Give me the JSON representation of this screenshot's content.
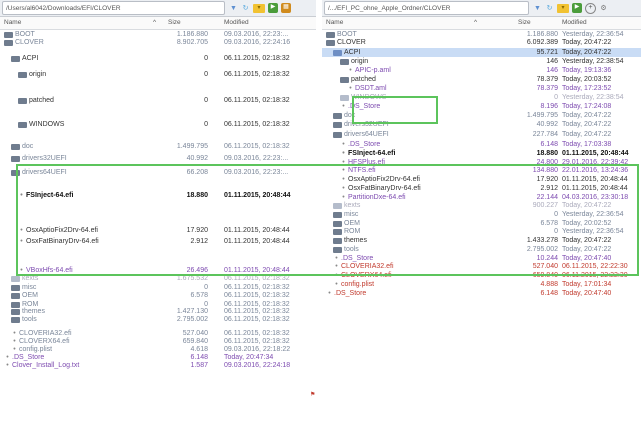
{
  "left": {
    "path": "/Users/al6042/Downloads/EFI/CLOVER",
    "columns": {
      "name": "Name",
      "size": "Size",
      "modified": "Modified"
    },
    "rows": [
      {
        "name": "BOOT",
        "size": "1.186.880",
        "modified": "09.03.2016, 22:23:...",
        "type": "folder",
        "indent": 0,
        "style": "muted"
      },
      {
        "name": "CLOVER",
        "size": "8.902.705",
        "modified": "09.03.2016, 22:24:16",
        "type": "folder",
        "indent": 0,
        "style": "muted"
      },
      {
        "name": "ACPI",
        "size": "0",
        "modified": "06.11.2015, 02:18:32",
        "type": "folder",
        "indent": 1,
        "style": "normal"
      },
      {
        "name": "origin",
        "size": "0",
        "modified": "06.11.2015, 02:18:32",
        "type": "folder",
        "indent": 2,
        "style": "normal"
      },
      {
        "name": "patched",
        "size": "0",
        "modified": "06.11.2015, 02:18:32",
        "type": "folder",
        "indent": 2,
        "style": "normal"
      },
      {
        "name": "WINDOWS",
        "size": "0",
        "modified": "06.11.2015, 02:18:32",
        "type": "folder",
        "indent": 2,
        "style": "normal"
      },
      {
        "name": "doc",
        "size": "1.499.795",
        "modified": "06.11.2015, 02:18:32",
        "type": "folder",
        "indent": 1,
        "style": "muted"
      },
      {
        "name": "drivers32UEFI",
        "size": "40.992",
        "modified": "09.03.2016, 22:23:...",
        "type": "folder",
        "indent": 1,
        "style": "muted"
      },
      {
        "name": "drivers64UEFI",
        "size": "66.208",
        "modified": "09.03.2016, 22:23:...",
        "type": "folder",
        "indent": 1,
        "style": "muted"
      },
      {
        "name": "FSInject-64.efi",
        "size": "18.880",
        "modified": "01.11.2015, 20:48:44",
        "type": "file",
        "indent": 2,
        "style": "strong"
      },
      {
        "name": "OsxAptioFix2Drv-64.efi",
        "size": "17.920",
        "modified": "01.11.2015, 20:48:44",
        "type": "file",
        "indent": 2,
        "style": "normal"
      },
      {
        "name": "OsxFatBinaryDrv-64.efi",
        "size": "2.912",
        "modified": "01.11.2015, 20:48:44",
        "type": "file",
        "indent": 2,
        "style": "normal"
      },
      {
        "name": "VBoxHfs-64.efi",
        "size": "26.496",
        "modified": "01.11.2015, 20:48:44",
        "type": "file",
        "indent": 2,
        "style": "purple"
      },
      {
        "name": "kexts",
        "size": "1.675.532",
        "modified": "06.11.2015, 02:18:32",
        "type": "folder",
        "indent": 1,
        "style": "dim"
      },
      {
        "name": "misc",
        "size": "0",
        "modified": "06.11.2015, 02:18:32",
        "type": "folder",
        "indent": 1,
        "style": "muted"
      },
      {
        "name": "OEM",
        "size": "6.578",
        "modified": "06.11.2015, 02:18:32",
        "type": "folder",
        "indent": 1,
        "style": "muted"
      },
      {
        "name": "ROM",
        "size": "0",
        "modified": "06.11.2015, 02:18:32",
        "type": "folder",
        "indent": 1,
        "style": "muted"
      },
      {
        "name": "themes",
        "size": "1.427.130",
        "modified": "06.11.2015, 02:18:32",
        "type": "folder",
        "indent": 1,
        "style": "muted"
      },
      {
        "name": "tools",
        "size": "2.795.002",
        "modified": "06.11.2015, 02:18:32",
        "type": "folder",
        "indent": 1,
        "style": "muted"
      },
      {
        "name": "CLOVERIA32.efi",
        "size": "527.040",
        "modified": "06.11.2015, 02:18:32",
        "type": "file",
        "indent": 1,
        "style": "muted"
      },
      {
        "name": "CLOVERX64.efi",
        "size": "659.840",
        "modified": "06.11.2015, 02:18:32",
        "type": "file",
        "indent": 1,
        "style": "muted"
      },
      {
        "name": "config.plist",
        "size": "4.618",
        "modified": "09.03.2016, 22:18:22",
        "type": "file",
        "indent": 1,
        "style": "muted"
      },
      {
        "name": ".DS_Store",
        "size": "6.148",
        "modified": "Today, 20:47:34",
        "type": "file",
        "indent": 0,
        "style": "purple"
      },
      {
        "name": "Clover_Install_Log.txt",
        "size": "1.587",
        "modified": "09.03.2016, 22:24:18",
        "type": "file",
        "indent": 0,
        "style": "purple"
      }
    ]
  },
  "right": {
    "path": "/.../EFI_PC_ohne_Apple_Ordner/CLOVER",
    "columns": {
      "name": "Name",
      "size": "Size",
      "modified": "Modified"
    },
    "rows": [
      {
        "name": "BOOT",
        "size": "1.186.880",
        "modified": "Yesterday, 22:36:54",
        "type": "folder",
        "indent": 0,
        "style": "muted"
      },
      {
        "name": "CLOVER",
        "size": "6.092.389",
        "modified": "Today, 20:47:22",
        "type": "folder",
        "indent": 0,
        "style": "normal"
      },
      {
        "name": "ACPI",
        "size": "95.721",
        "modified": "Today, 20:47:22",
        "type": "folder",
        "indent": 1,
        "style": "sel"
      },
      {
        "name": "origin",
        "size": "146",
        "modified": "Yesterday, 22:38:54",
        "type": "folder",
        "indent": 2,
        "style": "normal"
      },
      {
        "name": "APIC-p.aml",
        "size": "146",
        "modified": "Today, 19:13:36",
        "type": "file",
        "indent": 3,
        "style": "purple"
      },
      {
        "name": "patched",
        "size": "78.379",
        "modified": "Today, 20:03:52",
        "type": "folder",
        "indent": 2,
        "style": "normal"
      },
      {
        "name": "DSDT.aml",
        "size": "78.379",
        "modified": "Today, 17:23:52",
        "type": "file",
        "indent": 3,
        "style": "purple"
      },
      {
        "name": "WINDOWS",
        "size": "0",
        "modified": "Yesterday, 22:38:54",
        "type": "folder",
        "indent": 2,
        "style": "dim"
      },
      {
        "name": ".DS_Store",
        "size": "8.196",
        "modified": "Today, 17:24:08",
        "type": "file",
        "indent": 2,
        "style": "purple"
      },
      {
        "name": "doc",
        "size": "1.499.795",
        "modified": "Today, 20:47:22",
        "type": "folder",
        "indent": 1,
        "style": "muted"
      },
      {
        "name": "drivers32UEFI",
        "size": "40.992",
        "modified": "Today, 20:47:22",
        "type": "folder",
        "indent": 1,
        "style": "muted"
      },
      {
        "name": "drivers64UEFI",
        "size": "227.784",
        "modified": "Today, 20:47:22",
        "type": "folder",
        "indent": 1,
        "style": "muted"
      },
      {
        "name": ".DS_Store",
        "size": "6.148",
        "modified": "Today, 17:03:38",
        "type": "file",
        "indent": 2,
        "style": "purple"
      },
      {
        "name": "FSInject-64.efi",
        "size": "18.880",
        "modified": "01.11.2015, 20:48:44",
        "type": "file",
        "indent": 2,
        "style": "strong"
      },
      {
        "name": "HFSPlus.efi",
        "size": "24.800",
        "modified": "29.01.2016, 22:39:42",
        "type": "file",
        "indent": 2,
        "style": "purple"
      },
      {
        "name": "NTFS.efi",
        "size": "134.880",
        "modified": "22.01.2016, 13:24:36",
        "type": "file",
        "indent": 2,
        "style": "purple"
      },
      {
        "name": "OsxAptioFix2Drv-64.efi",
        "size": "17.920",
        "modified": "01.11.2015, 20:48:44",
        "type": "file",
        "indent": 2,
        "style": "normal"
      },
      {
        "name": "OsxFatBinaryDrv-64.efi",
        "size": "2.912",
        "modified": "01.11.2015, 20:48:44",
        "type": "file",
        "indent": 2,
        "style": "normal"
      },
      {
        "name": "PartitionDxe-64.efi",
        "size": "22.144",
        "modified": "04.03.2016, 23:30:18",
        "type": "file",
        "indent": 2,
        "style": "purple"
      },
      {
        "name": "kexts",
        "size": "900.227",
        "modified": "Today, 20:47:22",
        "type": "folder",
        "indent": 1,
        "style": "dim"
      },
      {
        "name": "misc",
        "size": "0",
        "modified": "Yesterday, 22:36:54",
        "type": "folder",
        "indent": 1,
        "style": "muted"
      },
      {
        "name": "OEM",
        "size": "6.578",
        "modified": "Today, 20:02:52",
        "type": "folder",
        "indent": 1,
        "style": "muted"
      },
      {
        "name": "ROM",
        "size": "0",
        "modified": "Yesterday, 22:36:54",
        "type": "folder",
        "indent": 1,
        "style": "muted"
      },
      {
        "name": "themes",
        "size": "1.433.278",
        "modified": "Today, 20:47:22",
        "type": "folder",
        "indent": 1,
        "style": "normal"
      },
      {
        "name": "tools",
        "size": "2.795.002",
        "modified": "Today, 20:47:22",
        "type": "folder",
        "indent": 1,
        "style": "muted"
      },
      {
        "name": ".DS_Store",
        "size": "10.244",
        "modified": "Today, 20:47:40",
        "type": "file",
        "indent": 1,
        "style": "purple"
      },
      {
        "name": "CLOVERIA32.efi",
        "size": "527.040",
        "modified": "06.11.2015, 22:22:30",
        "type": "file",
        "indent": 1,
        "style": "red"
      },
      {
        "name": "CLOVERX64.efi",
        "size": "659.840",
        "modified": "06.11.2015, 22:22:30",
        "type": "file",
        "indent": 1,
        "style": "red"
      },
      {
        "name": "config.plist",
        "size": "4.888",
        "modified": "Today, 17:01:34",
        "type": "file",
        "indent": 1,
        "style": "red"
      },
      {
        "name": ".DS_Store",
        "size": "6.148",
        "modified": "Today, 20:47:40",
        "type": "file",
        "indent": 0,
        "style": "red"
      }
    ]
  },
  "toolbar_icons": [
    "funnel-icon",
    "sync-icon",
    "folder-icon",
    "green-action-icon",
    "grid-icon",
    "plus-icon",
    "gear-icon"
  ],
  "colors": {
    "highlight": "#5cc45c",
    "selection": "#c9dcf5",
    "purple_text": "#7d4bb0",
    "red_text": "#c13a2d"
  }
}
